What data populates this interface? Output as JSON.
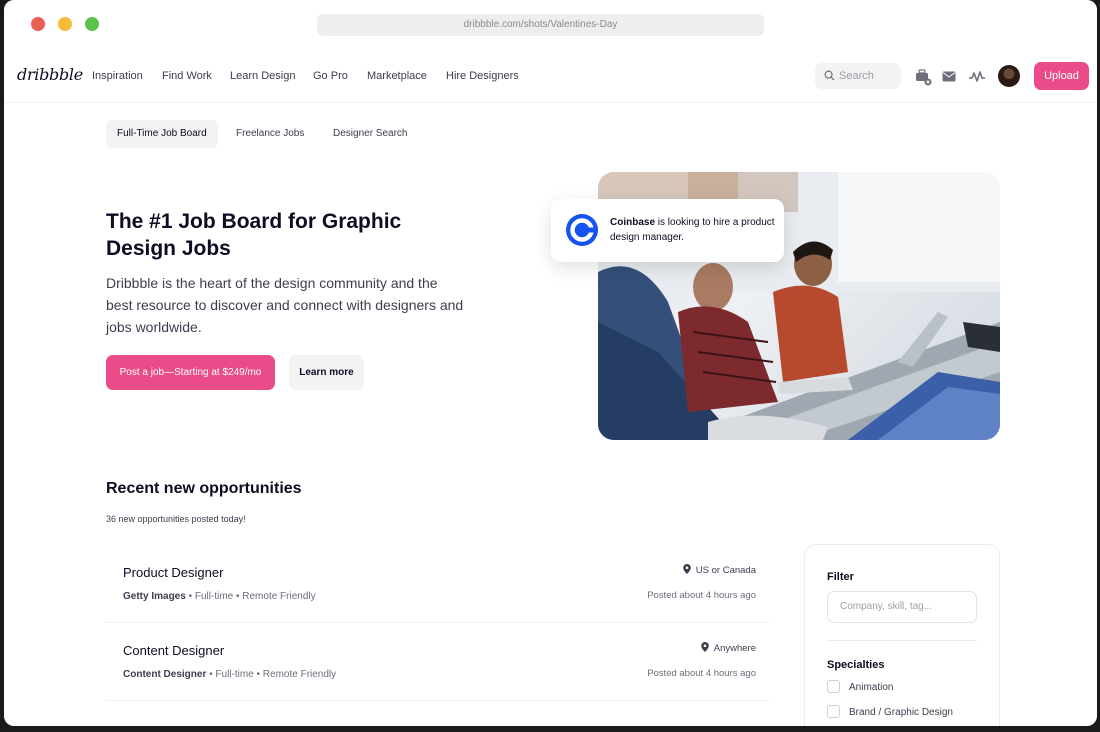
{
  "browser": {
    "url": "dribbble.com/shots/Valentines-Day"
  },
  "nav": {
    "logo": "dribbble",
    "links": [
      "Inspiration",
      "Find Work",
      "Learn Design",
      "Go Pro",
      "Marketplace",
      "Hire Designers"
    ],
    "search_placeholder": "Search",
    "upload_label": "Upload"
  },
  "tabs": [
    "Full-Time Job Board",
    "Freelance Jobs",
    "Designer Search"
  ],
  "hero": {
    "title": "The #1 Job Board for Graphic Design Jobs",
    "description": "Dribbble is the heart of the design community and the best resource to discover and connect with designers and jobs worldwide.",
    "primary_button": "Post a job—Starting at $249/mo",
    "secondary_button": "Learn more"
  },
  "hire_card": {
    "company": "Coinbase",
    "message": " is looking to hire a product design manager."
  },
  "recent": {
    "title": "Recent new opportunities",
    "subtitle": "36 new opportunities posted today!"
  },
  "jobs": [
    {
      "title": "Product Designer",
      "company": "Getty Images",
      "details": " • Full-time • Remote Friendly",
      "location": "US or Canada",
      "posted": "Posted about 4 hours ago"
    },
    {
      "title": "Content Designer",
      "company": "Content Designer",
      "details": " • Full-time • Remote Friendly",
      "location": "Anywhere",
      "posted": "Posted about 4 hours ago"
    }
  ],
  "filter": {
    "title": "Filter",
    "placeholder": "Company, skill, tag...",
    "specialties_title": "Specialties",
    "specialties": [
      "Animation",
      "Brand / Graphic Design"
    ]
  },
  "colors": {
    "accent": "#ea4c89",
    "coinbase": "#1652f0"
  }
}
